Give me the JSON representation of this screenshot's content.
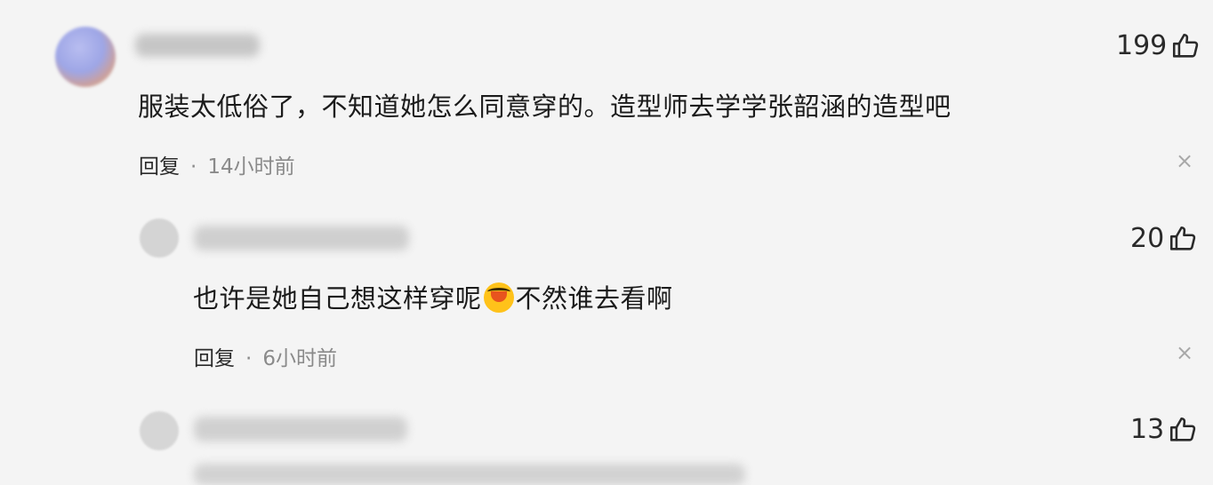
{
  "comments": [
    {
      "text": "服装太低俗了，不知道她怎么同意穿的。造型师去学学张韶涵的造型吧",
      "reply_label": "回复",
      "separator": "·",
      "time": "14小时前",
      "likes": "199",
      "close_glyph": "×"
    },
    {
      "text_before_emoji": "也许是她自己想这样穿呢",
      "text_after_emoji": "不然谁去看啊",
      "reply_label": "回复",
      "separator": "·",
      "time": "6小时前",
      "likes": "20",
      "close_glyph": "×"
    },
    {
      "likes": "13"
    }
  ],
  "icons": {
    "like": "thumbs-up-icon",
    "close": "close-icon",
    "emoji": "crying-laughing-emoji-icon"
  },
  "colors": {
    "background": "#f4f4f4",
    "meta_text": "#8a8a8a",
    "primary_text": "#1b1b1b"
  }
}
